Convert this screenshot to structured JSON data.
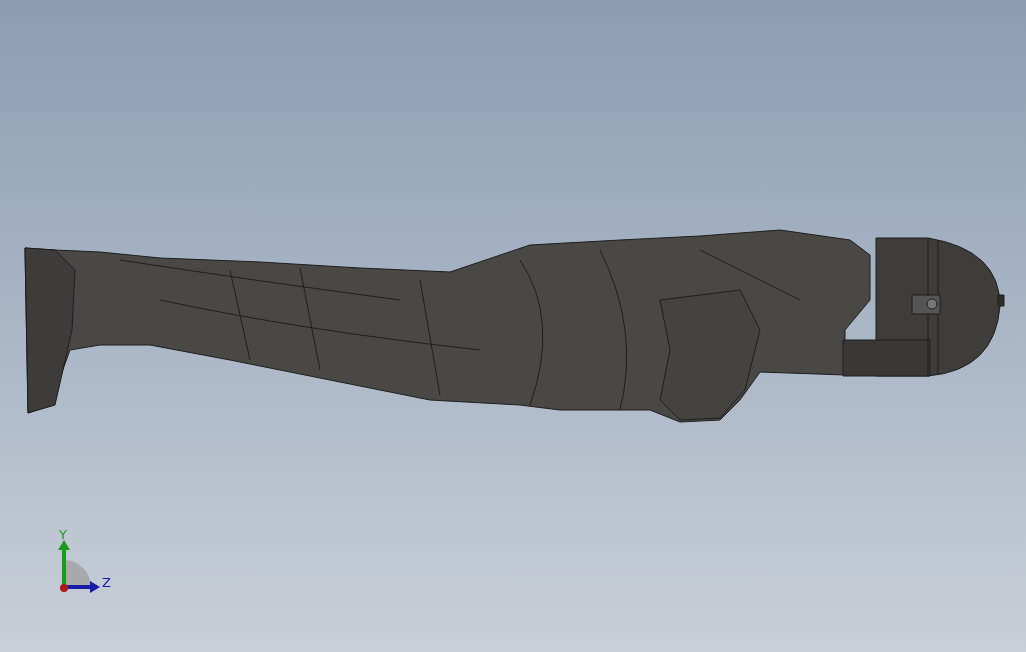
{
  "viewport": {
    "model": {
      "kind": "figure"
    }
  },
  "triad": {
    "axes": [
      {
        "label": "Y",
        "color": "#1a9a1a",
        "kind": "vertical"
      },
      {
        "label": "Z",
        "color": "#1a1aa8",
        "kind": "horizontal"
      }
    ]
  }
}
